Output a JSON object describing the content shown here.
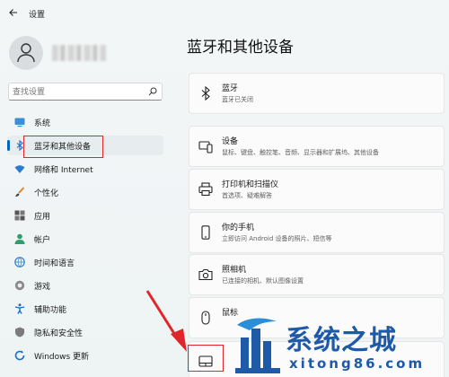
{
  "titlebar": {
    "title": "设置"
  },
  "sidebar": {
    "search_placeholder": "查找设置",
    "items": [
      {
        "label": "系统",
        "icon": "monitor-icon"
      },
      {
        "label": "蓝牙和其他设备",
        "icon": "bluetooth-icon",
        "active": true
      },
      {
        "label": "网络和 Internet",
        "icon": "wifi-icon"
      },
      {
        "label": "个性化",
        "icon": "brush-icon"
      },
      {
        "label": "应用",
        "icon": "apps-icon"
      },
      {
        "label": "帐户",
        "icon": "person-icon"
      },
      {
        "label": "时间和语言",
        "icon": "globe-clock-icon"
      },
      {
        "label": "游戏",
        "icon": "gamepad-icon"
      },
      {
        "label": "辅助功能",
        "icon": "accessibility-icon"
      },
      {
        "label": "隐私和安全性",
        "icon": "shield-icon"
      },
      {
        "label": "Windows 更新",
        "icon": "refresh-icon"
      }
    ]
  },
  "main": {
    "title": "蓝牙和其他设备",
    "cards": [
      {
        "title": "蓝牙",
        "desc": "蓝牙已关闭",
        "icon": "bluetooth-icon"
      },
      {
        "title": "设备",
        "desc": "鼠标、键盘、触控笔、音频、显示器和扩展坞、其他设备",
        "icon": "devices-icon"
      },
      {
        "title": "打印机和扫描仪",
        "desc": "首选项、疑难解答",
        "icon": "printer-icon"
      },
      {
        "title": "你的手机",
        "desc": "立即访问 Android 设备的照片、短信等",
        "icon": "phone-icon"
      },
      {
        "title": "照相机",
        "desc": "已连接的相机、默认图像设置",
        "icon": "camera-icon"
      },
      {
        "title": "鼠标",
        "desc": "",
        "icon": "mouse-icon"
      },
      {
        "title": "",
        "desc": "",
        "icon": "touchpad-icon"
      }
    ]
  },
  "watermark": {
    "text": "系统之城",
    "domain": "xitong86.com"
  },
  "colors": {
    "accent": "#0067c0",
    "highlight": "#e0262b",
    "watermark": "#1f5aa8"
  }
}
